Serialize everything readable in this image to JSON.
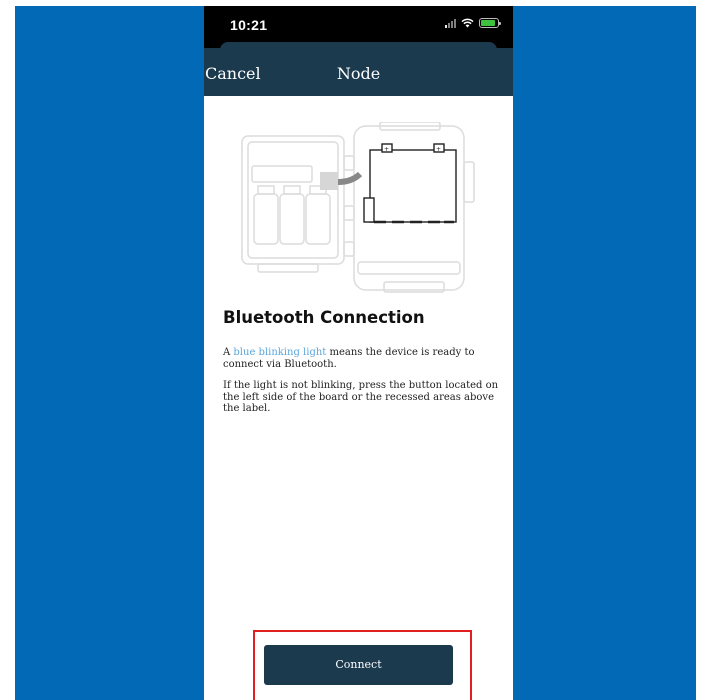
{
  "status_bar": {
    "time": "10:21",
    "icons": [
      "signal-icon",
      "wifi-icon",
      "battery-charging-icon"
    ]
  },
  "nav": {
    "cancel_label": "Cancel",
    "title": "Node"
  },
  "content": {
    "heading": "Bluetooth Connection",
    "paragraph1_prefix": "A ",
    "paragraph1_link": "blue blinking light",
    "paragraph1_suffix": " means the device is ready to connect via Bluetooth.",
    "paragraph2": "If the light is not blinking, press the button located on the left side of the board or the recessed areas above the label."
  },
  "actions": {
    "connect_label": "Connect"
  },
  "colors": {
    "background": "#0269b6",
    "nav_bar": "#1c3a4e",
    "link": "#5aa6dc",
    "highlight": "#e02020",
    "button": "#1c3a4e"
  }
}
